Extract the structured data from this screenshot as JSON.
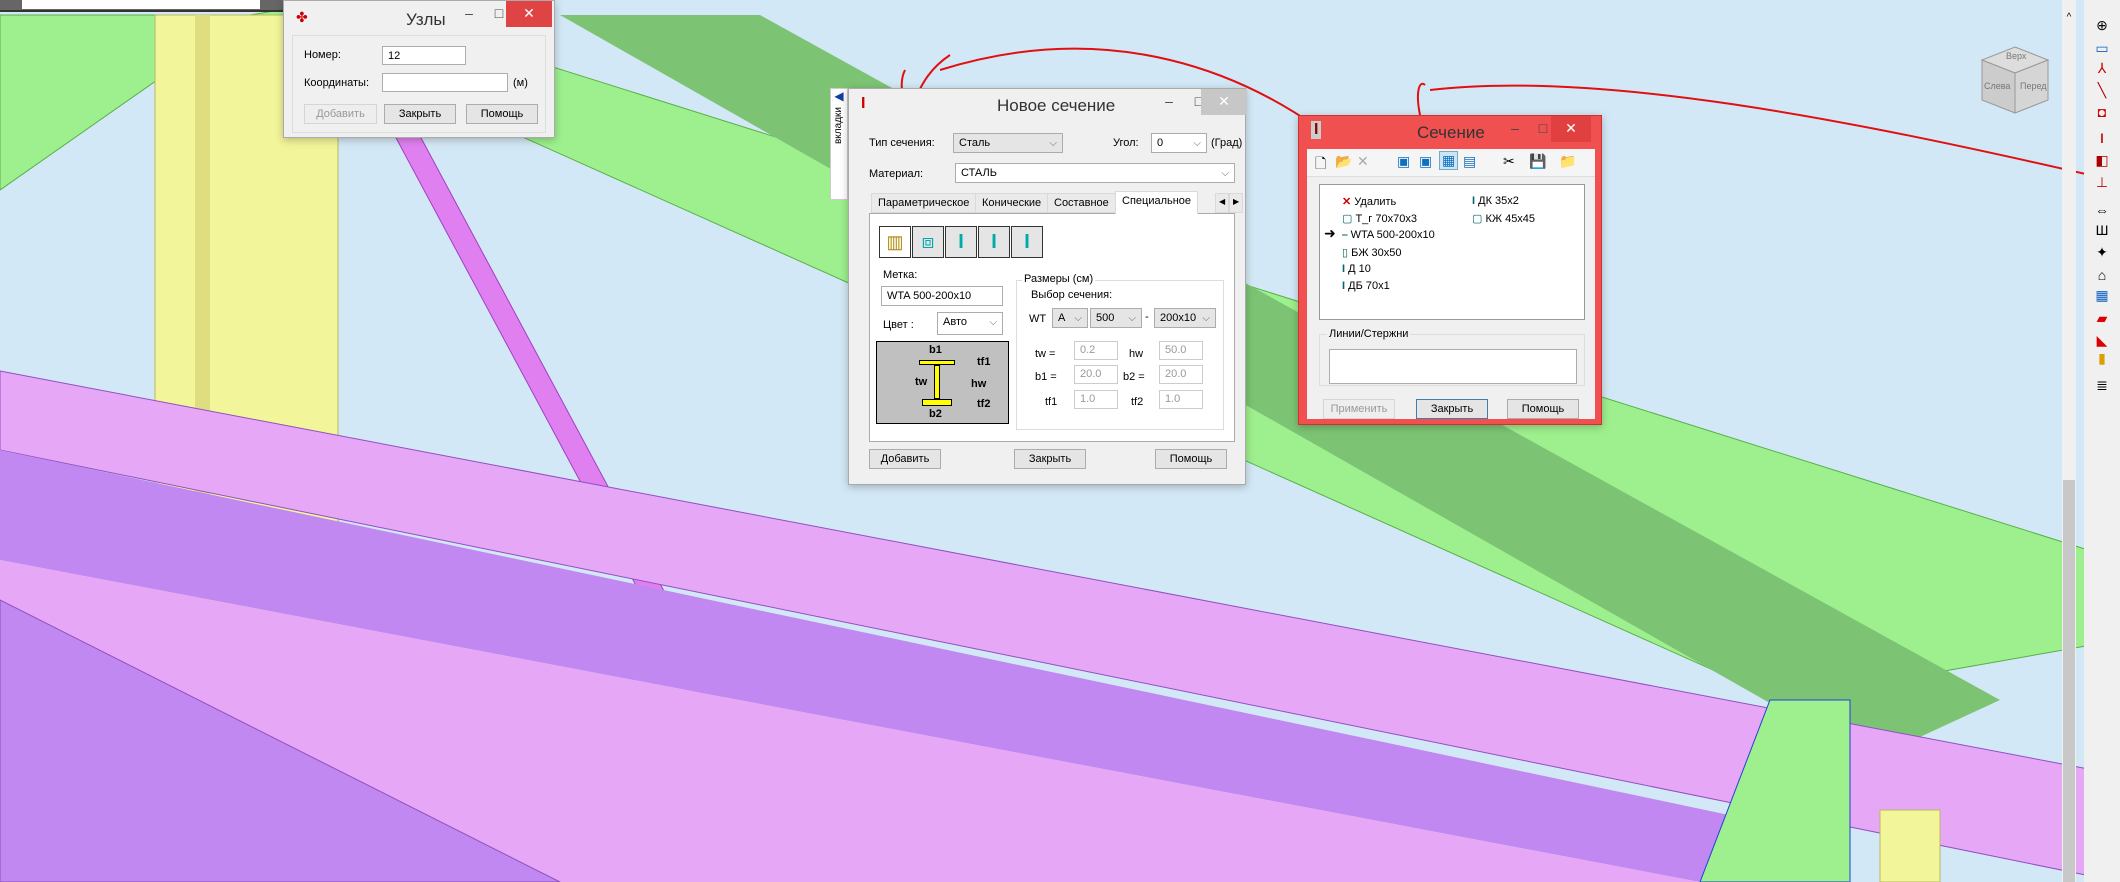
{
  "uzly": {
    "title": "Узлы",
    "number_label": "Номер:",
    "number_value": "12",
    "coords_label": "Координаты:",
    "coords_value": "",
    "unit": "(м)",
    "add": "Добавить",
    "close": "Закрыть",
    "help": "Помощь"
  },
  "new_section": {
    "title": "Новое сечение",
    "side_tab": "вкладки",
    "type_label": "Тип сечения:",
    "type_value": "Сталь",
    "angle_label": "Угол:",
    "angle_value": "0",
    "angle_unit": "(Град)",
    "material_label": "Материал:",
    "material_value": "СТАЛЬ",
    "tabs": [
      "Параметрическое",
      "Конические",
      "Составное",
      "Специальное"
    ],
    "mark_label": "Метка:",
    "mark_value": "WTA 500-200x10",
    "color_label": "Цвет :",
    "color_value": "Авто",
    "dims_group": "Размеры (см)",
    "choice_label": "Выбор сечения:",
    "wt_label": "WT",
    "wt_a": "A",
    "wt_h": "500",
    "wt_b": "200x10",
    "params": {
      "tw_l": "tw  =",
      "tw": "0.2",
      "hw_l": "hw",
      "hw": "50.0",
      "b1_l": "b1  =",
      "b1": "20.0",
      "b2_l": "b2  =",
      "b2": "20.0",
      "tf1_l": "tf1",
      "tf1": "1.0",
      "tf2_l": "tf2",
      "tf2": "1.0"
    },
    "diagram": {
      "b1": "b1",
      "b2": "b2",
      "tw": "tw",
      "hw": "hw",
      "tf1": "tf1",
      "tf2": "tf2"
    },
    "add": "Добавить",
    "close": "Закрыть",
    "help": "Помощь"
  },
  "section": {
    "title": "Сечение",
    "list_left": [
      "Удалить",
      "Т_г 70x70x3",
      "WTA 500-200x10",
      "БЖ 30x50",
      "Д 10",
      "ДБ 70x1"
    ],
    "list_right": [
      "ДК 35x2",
      "КЖ 45x45"
    ],
    "lines_label": "Линии/Стержни",
    "apply": "Применить",
    "close": "Закрыть",
    "help": "Помощь",
    "accent": "#f05050"
  },
  "viewcube": {
    "top": "Верх",
    "left": "Слева",
    "front": "Перед"
  }
}
